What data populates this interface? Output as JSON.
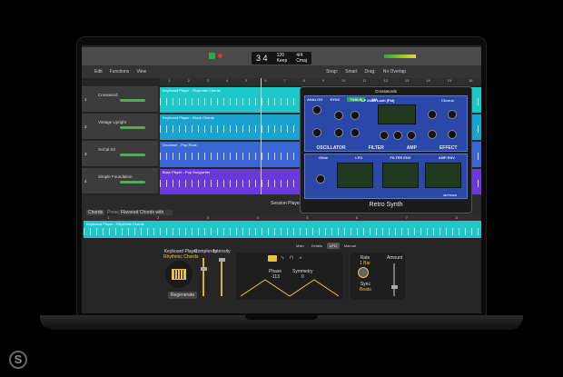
{
  "app": {
    "transport": {
      "position": "3 4",
      "tempo": "120",
      "tempo_label": "Keep",
      "signature": "4/4",
      "key": "Cmaj"
    },
    "toolbar": {
      "edit": "Edit",
      "functions": "Functions",
      "view": "View",
      "snap_label": "Snap:",
      "snap": "Smart",
      "drag_label": "Drag:",
      "drag": "No Overlap"
    },
    "ruler": [
      "1",
      "2",
      "3",
      "4",
      "5",
      "6",
      "7",
      "8",
      "9",
      "10",
      "11",
      "12",
      "13",
      "14",
      "15",
      "16"
    ],
    "tracks": [
      {
        "num": "1",
        "name": "Crossword",
        "region": "Keyboard Player - Rhythmic Chords",
        "color": "#1ec8c8"
      },
      {
        "num": "2",
        "name": "Vintage Upright",
        "region": "Keyboard Player - Block Chords",
        "color": "#1aa3cf"
      },
      {
        "num": "3",
        "name": "SoCal Kit",
        "region": "Drummer - Pop Rock",
        "color": "#3a66d6"
      },
      {
        "num": "4",
        "name": "Simple Foundation",
        "region": "Bass Player - Pop Songwriter",
        "color": "#6a3ad8"
      }
    ],
    "synth": {
      "window_title": "Crosswords",
      "name": "Retro Synth",
      "tabs": [
        "ANALOG",
        "SYNC",
        "TABLE",
        "FM"
      ],
      "filter_type": "LP 24dB Lush (Fat)",
      "effect": "Chorus",
      "sections": [
        "OSCILLATOR",
        "FILTER",
        "AMP",
        "EFFECT"
      ],
      "lower": [
        "Glide",
        "LFO",
        "FILTER ENV",
        "AMP ENV"
      ],
      "settings": "SETTINGS"
    },
    "session": {
      "title": "Session Player",
      "chords": "Chords",
      "preset_label": "Preset:",
      "preset": "Flavored Chords with Busy LH",
      "ruler": [
        "1",
        "2",
        "3",
        "4",
        "5",
        "6",
        "7",
        "8"
      ],
      "region": "Keyboard Player - Rhythmic Chords"
    },
    "editor": {
      "tabs": [
        "Main",
        "Details",
        "LFO",
        "Manual"
      ],
      "player": "Keyboard Player",
      "style": "Rhythmic Chords",
      "complexity": "Complexity",
      "intensity": "Intensity",
      "regenerate": "Regenerate",
      "phase_label": "Phase",
      "phase": "-113",
      "symmetry_label": "Symmetry",
      "symmetry": "0",
      "rate_label": "Rate",
      "rate": "1 Bar",
      "sync_label": "Sync",
      "sync": "Beats",
      "amount": "Amount"
    }
  },
  "watermark": "S",
  "colors": {
    "accent": "#e8c43a",
    "region_teal": "#1ec8c8",
    "synth_blue": "#2b47a8"
  }
}
